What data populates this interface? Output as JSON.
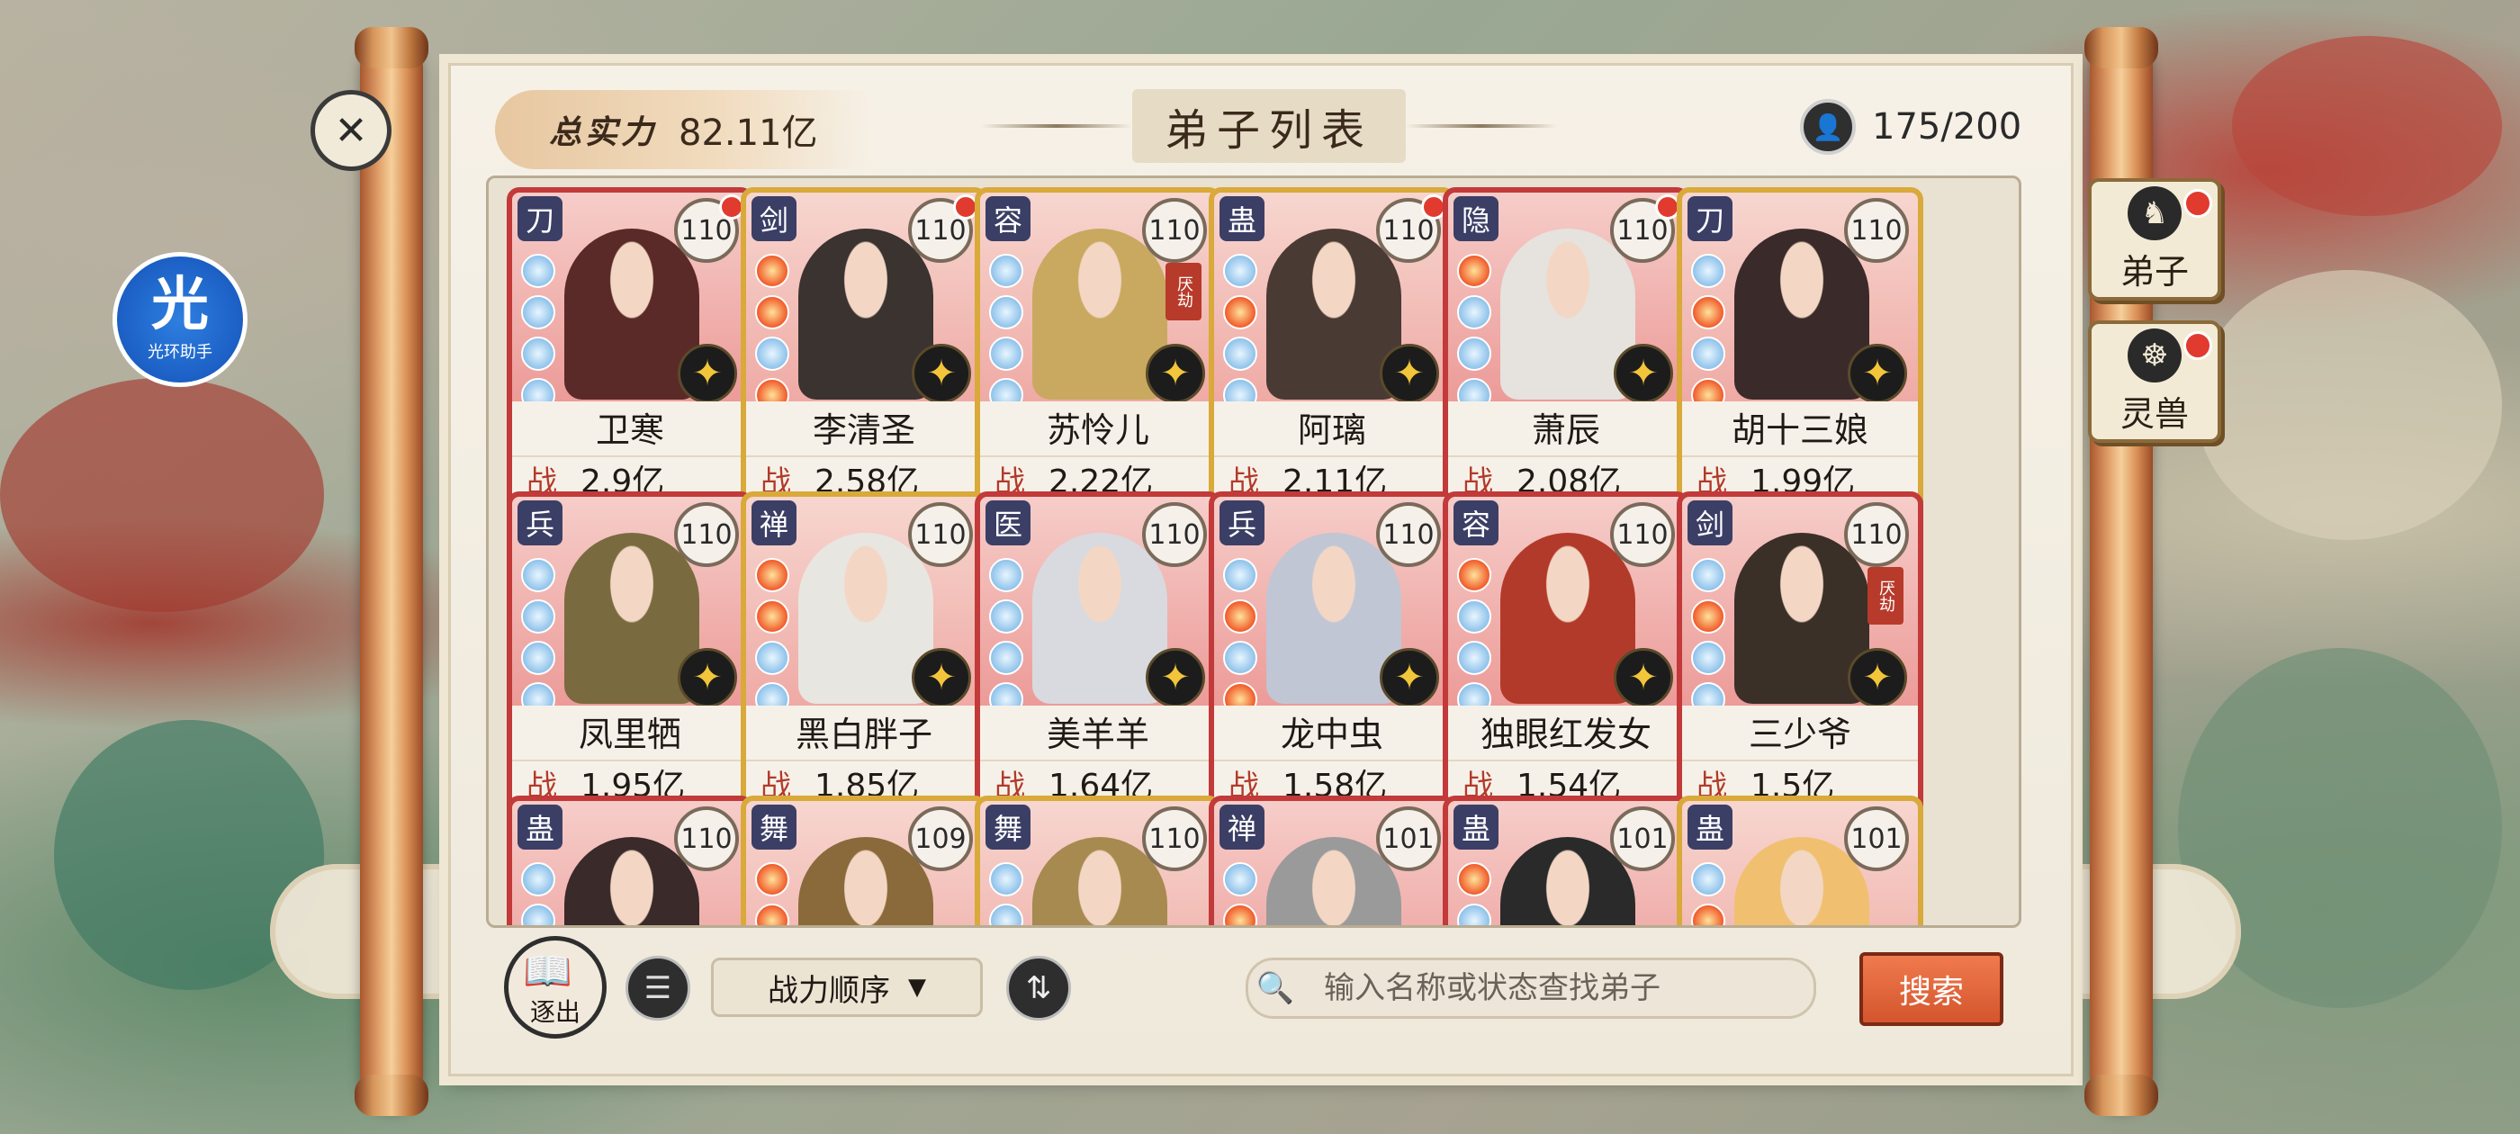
{
  "header": {
    "power_label": "总实力",
    "power_value": "82.11亿",
    "title": "弟子列表",
    "count": "175/200"
  },
  "side_tabs": [
    {
      "label": "弟子",
      "has_dot": true
    },
    {
      "label": "灵兽",
      "has_dot": true
    }
  ],
  "helper": {
    "glyph": "光",
    "label": "光环助手"
  },
  "power_key": "战",
  "cards": [
    {
      "type": "刀",
      "level": "110",
      "name": "卫寒",
      "power": "2.9亿",
      "frame": "red",
      "dot": true
    },
    {
      "type": "剑",
      "level": "110",
      "name": "李清圣",
      "power": "2.58亿",
      "frame": "gold",
      "dot": true
    },
    {
      "type": "容",
      "level": "110",
      "name": "苏怜儿",
      "power": "2.22亿",
      "frame": "gold",
      "dot": false,
      "seal": "厌劫"
    },
    {
      "type": "蛊",
      "level": "110",
      "name": "阿璃",
      "power": "2.11亿",
      "frame": "gold",
      "dot": true
    },
    {
      "type": "隐",
      "level": "110",
      "name": "萧辰",
      "power": "2.08亿",
      "frame": "red",
      "dot": true
    },
    {
      "type": "刀",
      "level": "110",
      "name": "胡十三娘",
      "power": "1.99亿",
      "frame": "gold",
      "dot": false
    },
    {
      "type": "兵",
      "level": "110",
      "name": "凤里牺",
      "power": "1.95亿",
      "frame": "red",
      "dot": false
    },
    {
      "type": "禅",
      "level": "110",
      "name": "黑白胖子",
      "power": "1.85亿",
      "frame": "gold",
      "dot": false
    },
    {
      "type": "医",
      "level": "110",
      "name": "美羊羊",
      "power": "1.64亿",
      "frame": "red",
      "dot": false
    },
    {
      "type": "兵",
      "level": "110",
      "name": "龙中虫",
      "power": "1.58亿",
      "frame": "red",
      "dot": false
    },
    {
      "type": "容",
      "level": "110",
      "name": "独眼红发女",
      "power": "1.54亿",
      "frame": "red",
      "dot": false
    },
    {
      "type": "剑",
      "level": "110",
      "name": "三少爷",
      "power": "1.5亿",
      "frame": "red",
      "dot": false,
      "seal": "厌劫"
    },
    {
      "type": "蛊",
      "level": "110",
      "name": "",
      "power": "",
      "frame": "red",
      "dot": false
    },
    {
      "type": "舞",
      "level": "109",
      "name": "",
      "power": "",
      "frame": "gold",
      "dot": false
    },
    {
      "type": "舞",
      "level": "110",
      "name": "",
      "power": "",
      "frame": "gold",
      "dot": false
    },
    {
      "type": "禅",
      "level": "101",
      "name": "",
      "power": "",
      "frame": "red",
      "dot": false
    },
    {
      "type": "蛊",
      "level": "101",
      "name": "",
      "power": "",
      "frame": "red",
      "dot": false
    },
    {
      "type": "蛊",
      "level": "101",
      "name": "",
      "power": "",
      "frame": "gold",
      "dot": false
    }
  ],
  "bottom": {
    "exit_label": "逐出",
    "sort_value": "战力顺序",
    "search_placeholder": "输入名称或状态查找弟子",
    "search_button": "搜索"
  },
  "colors": {
    "red_frame": "#c23a3a",
    "gold_frame": "#d9a93a",
    "search_button": "#e06a3e"
  }
}
